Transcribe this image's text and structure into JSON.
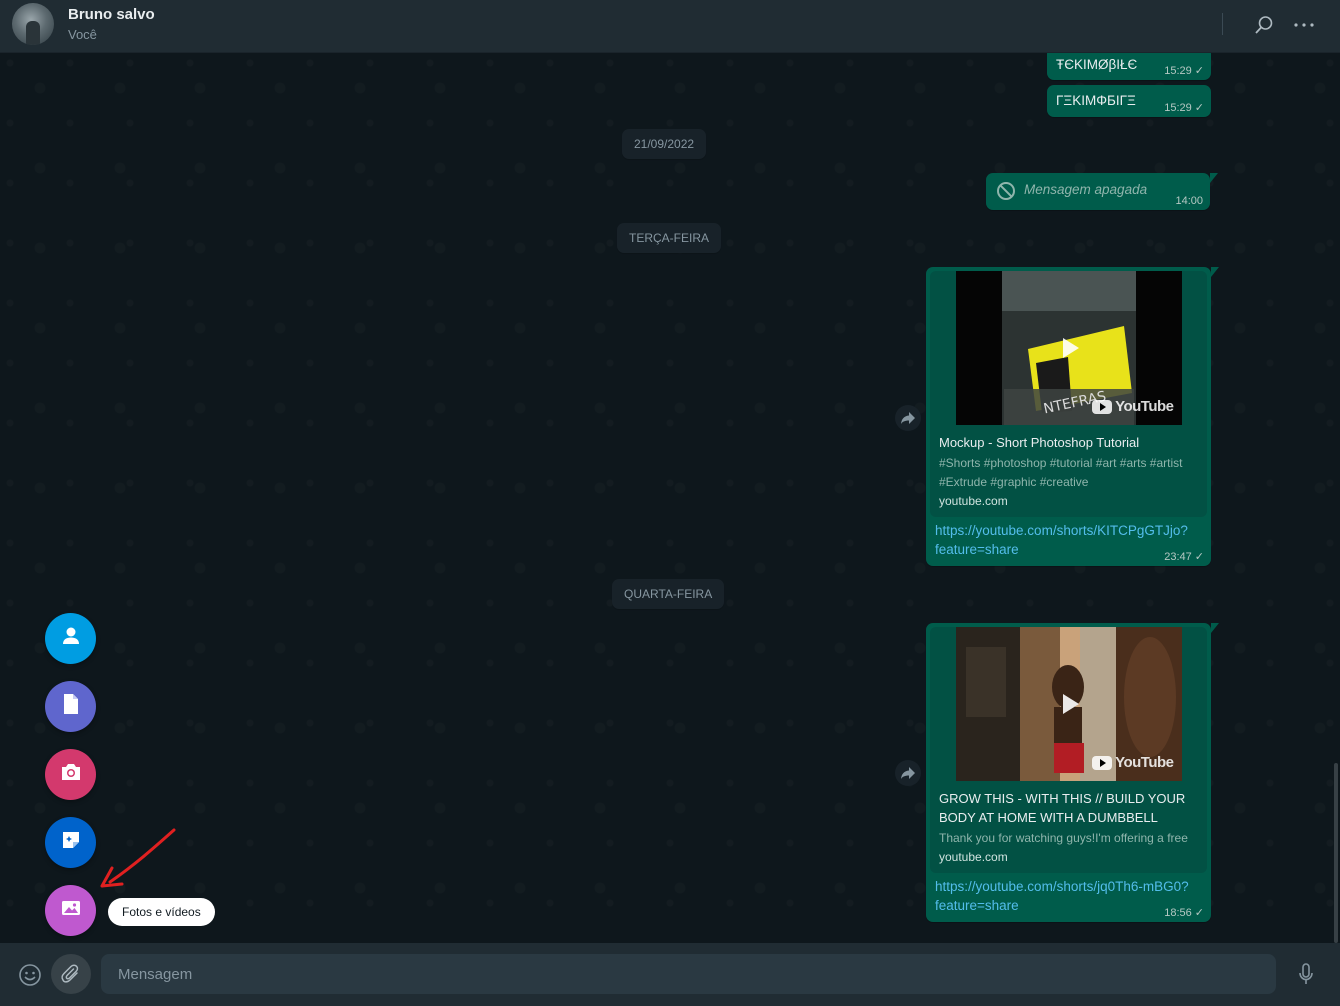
{
  "header": {
    "contact_name": "Bruno salvo",
    "contact_subtitle": "Você"
  },
  "messages": {
    "msg1": {
      "text": "ŦЄKIMØβIŁЄ",
      "time": "15:29"
    },
    "msg2": {
      "text": "ΓΞKIMΦБIΓΞ",
      "time": "15:29"
    },
    "day1": "21/09/2022",
    "deleted": {
      "text": "Mensagem apagada",
      "time": "14:00"
    },
    "day2": "TERÇA-FEIRA",
    "link1": {
      "title": "Mockup - Short Photoshop Tutorial",
      "desc_line1": "#Shorts #photoshop #tutorial #art #arts #artist",
      "desc_line2": "#Extrude #graphic #creative",
      "domain": "youtube.com",
      "url_line1": "https://youtube.com/shorts/KITCPgGTJjo?",
      "url_line2": "feature=share",
      "time": "23:47",
      "logo_text": "YouTube"
    },
    "day3": "QUARTA-FEIRA",
    "link2": {
      "title_line1": "GROW THIS - WITH THIS // BUILD YOUR",
      "title_line2": "BODY AT HOME WITH A DUMBBELL",
      "desc": "Thank you for watching guys!I'm offering a free",
      "domain": "youtube.com",
      "url_line1": "https://youtube.com/shorts/jq0Th6-mBG0?",
      "url_line2": "feature=share",
      "time": "18:56",
      "logo_text": "YouTube"
    }
  },
  "attach_menu": {
    "items": [
      {
        "name": "contact",
        "color": "#009de2",
        "icon": "person-icon"
      },
      {
        "name": "document",
        "color": "#5f66cd",
        "icon": "document-icon"
      },
      {
        "name": "camera",
        "color": "#d3396d",
        "icon": "camera-icon"
      },
      {
        "name": "sticker",
        "color": "#0063cb",
        "icon": "sticker-icon"
      },
      {
        "name": "photos-videos",
        "color": "#bf59cf",
        "icon": "image-icon"
      }
    ],
    "tooltip": "Fotos e vídeos"
  },
  "footer": {
    "input_placeholder": "Mensagem"
  },
  "colors": {
    "outgoing_bubble": "#005c4b",
    "header_bg": "#202c33",
    "link_color": "#53bdeb",
    "annotation_arrow": "#e02020"
  }
}
